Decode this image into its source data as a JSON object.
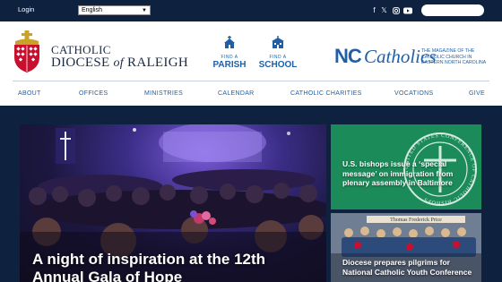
{
  "topbar": {
    "login": "Login",
    "language": "English",
    "social_icons": [
      "facebook-icon",
      "x-icon",
      "instagram-icon",
      "youtube-icon"
    ]
  },
  "header": {
    "diocese_line1": "CATHOLIC",
    "diocese_line2_a": "DIOCESE ",
    "diocese_line2_of": "of",
    "diocese_line2_b": " RALEIGH",
    "find_parish_small": "FIND A",
    "find_parish_big": "PARISH",
    "find_school_small": "FIND A",
    "find_school_big": "SCHOOL",
    "nc_mark": "NC",
    "nc_word": "Catholics",
    "nc_desc": "THE MAGAZINE OF THE CATHOLIC CHURCH IN EASTERN NORTH CAROLINA"
  },
  "nav": [
    "ABOUT",
    "OFFICES",
    "MINISTRIES",
    "CALENDAR",
    "CATHOLIC CHARITIES",
    "VOCATIONS",
    "GIVE"
  ],
  "hero": {
    "title": "A night of inspiration at the 12th Annual Gala of Hope"
  },
  "cards": [
    {
      "title": "U.S. bishops issue a ‘special message’ on immigration from plenary assembly in Baltimore",
      "seal_text": "UNITED STATES CONFERENCE OF CATHOLIC BISHOPS"
    },
    {
      "title": "Diocese prepares pilgrims for National Catholic Youth Conference",
      "sign_text": "Thomas Frederick Price"
    }
  ],
  "colors": {
    "navy": "#0e2240",
    "brand_blue": "#1f5fa8",
    "card_green": "#1b8b5a",
    "crest_red": "#c8102e"
  }
}
